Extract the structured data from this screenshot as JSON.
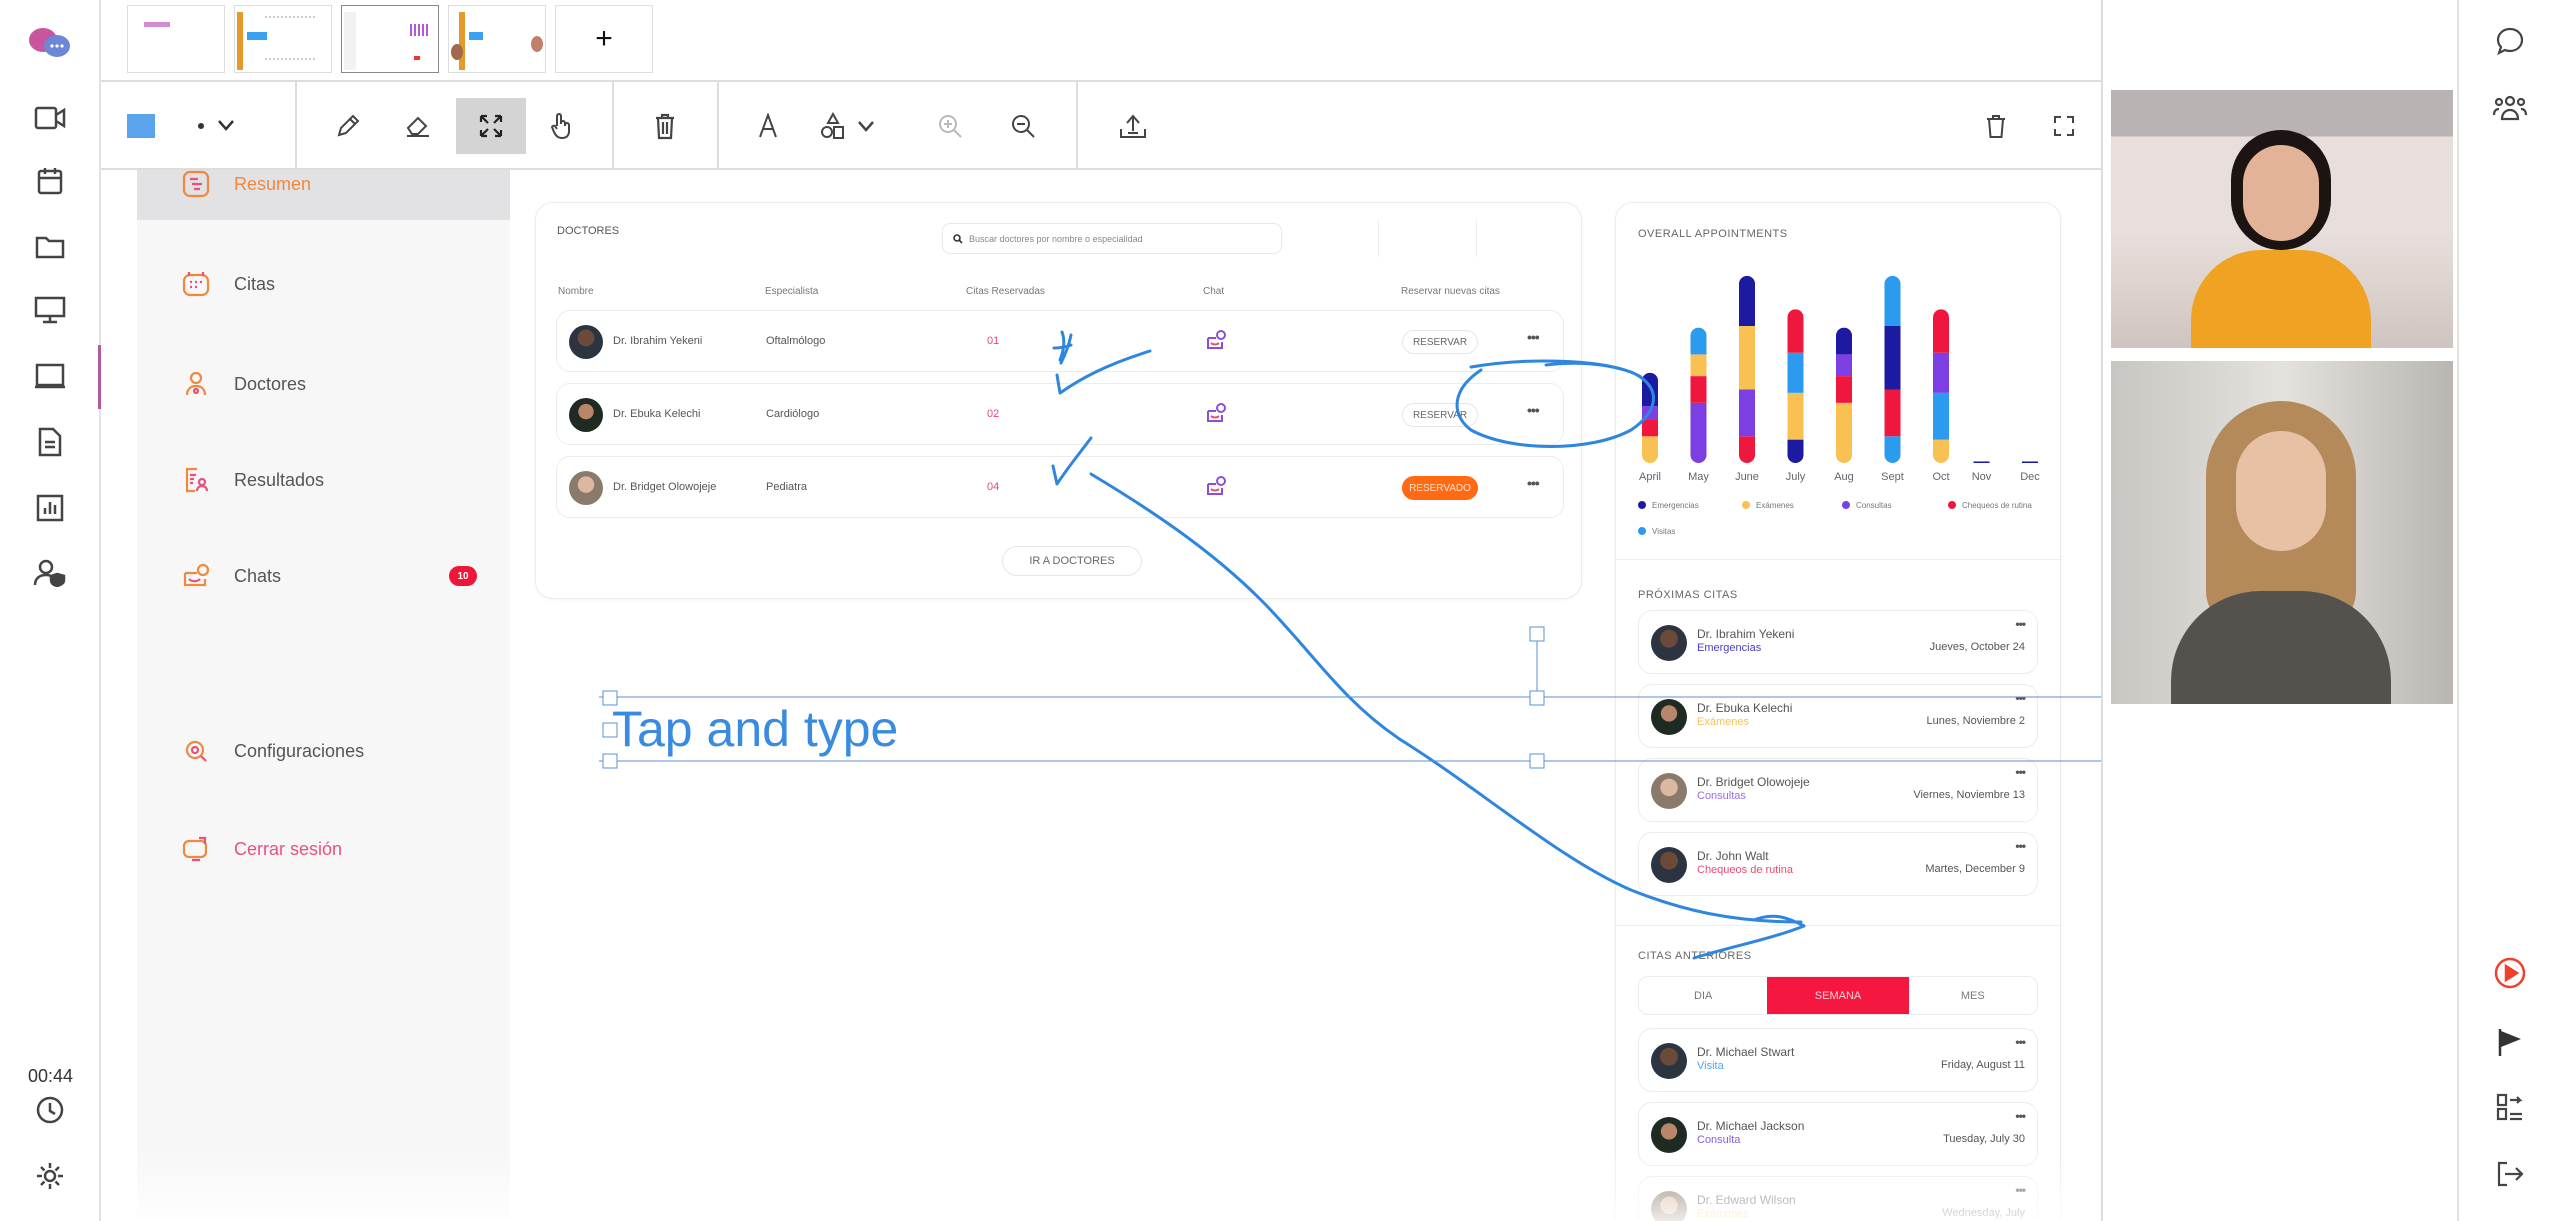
{
  "rail": {
    "timer": "00:44"
  },
  "thumbnails": {
    "add_label": "+"
  },
  "toolbar": {
    "color": "#5ba3ec",
    "active_tool": "select"
  },
  "sidebar": {
    "items": [
      {
        "label": "Resumen",
        "icon": "summary-icon"
      },
      {
        "label": "Citas",
        "icon": "calendar-icon"
      },
      {
        "label": "Doctores",
        "icon": "doctor-icon"
      },
      {
        "label": "Resultados",
        "icon": "results-icon"
      },
      {
        "label": "Chats",
        "icon": "chat-icon",
        "badge": "10"
      },
      {
        "label": "Configuraciones",
        "icon": "settings-icon"
      },
      {
        "label": "Cerrar sesión",
        "icon": "logout-icon"
      }
    ]
  },
  "doctors": {
    "title": "DOCTORES",
    "search_placeholder": "Buscar doctores por nombre o especialidad",
    "headers": [
      "Nombre",
      "Especialista",
      "Citas Reservadas",
      "Chat",
      "Reservar nuevas citas"
    ],
    "rows": [
      {
        "name": "Dr. Ibrahim Yekeni",
        "specialty": "Oftalmólogo",
        "count": "01",
        "action": "RESERVAR"
      },
      {
        "name": "Dr. Ebuka Kelechi",
        "specialty": "Cardiólogo",
        "count": "02",
        "action": "RESERVAR"
      },
      {
        "name": "Dr. Bridget Olowojeje",
        "specialty": "Pediatra",
        "count": "04",
        "action": "RESERVADO"
      }
    ],
    "more_button": "IR A DOCTORES"
  },
  "annotation": {
    "text": "Tap and type",
    "ink_color": "#2e86de"
  },
  "chart_data": {
    "type": "bar",
    "stacked": true,
    "title": "OVERALL APPOINTMENTS",
    "categories": [
      "April",
      "May",
      "June",
      "July",
      "Aug",
      "Sept",
      "Oct",
      "Nov",
      "Dec"
    ],
    "legend": [
      {
        "name": "Emergencias",
        "color": "#1c1aa0"
      },
      {
        "name": "Exámenes",
        "color": "#f9c152"
      },
      {
        "name": "Consultas",
        "color": "#7b3fe4"
      },
      {
        "name": "Chequeos de rutina",
        "color": "#f0173f"
      },
      {
        "name": "Visitas",
        "color": "#2b9bf0"
      }
    ],
    "stacks": [
      [
        [
          "Exámenes",
          8
        ],
        [
          "Chequeos de rutina",
          5
        ],
        [
          "Consultas",
          4
        ],
        [
          "Emergencias",
          10
        ]
      ],
      [
        [
          "Consultas",
          18
        ],
        [
          "Chequeos de rutina",
          8
        ],
        [
          "Exámenes",
          6.5
        ],
        [
          "Visitas",
          8
        ]
      ],
      [
        [
          "Chequeos de rutina",
          8
        ],
        [
          "Consultas",
          14
        ],
        [
          "Exámenes",
          19
        ],
        [
          "Emergencias",
          15
        ]
      ],
      [
        [
          "Emergencias",
          7
        ],
        [
          "Exámenes",
          14
        ],
        [
          "Visitas",
          12
        ],
        [
          "Chequeos de rutina",
          13
        ]
      ],
      [
        [
          "Exámenes",
          18
        ],
        [
          "Chequeos de rutina",
          8
        ],
        [
          "Consultas",
          6.5
        ],
        [
          "Emergencias",
          8
        ]
      ],
      [
        [
          "Visitas",
          8
        ],
        [
          "Chequeos de rutina",
          14
        ],
        [
          "Emergencias",
          19
        ],
        [
          "Visitas",
          15
        ]
      ],
      [
        [
          "Exámenes",
          7
        ],
        [
          "Visitas",
          14
        ],
        [
          "Consultas",
          12
        ],
        [
          "Chequeos de rutina",
          13
        ]
      ],
      [
        [
          "Emergencias",
          0.5
        ]
      ],
      [
        [
          "Emergencias",
          0.5
        ]
      ]
    ],
    "ylim": [
      0,
      58
    ],
    "grid": false,
    "legend_position": "bottom"
  },
  "upcoming": {
    "title": "PRÓXIMAS CITAS",
    "items": [
      {
        "name": "Dr. Ibrahim Yekeni",
        "category": "Emergencias",
        "color": "#4a3fc0",
        "date": "Jueves, October 24"
      },
      {
        "name": "Dr. Ebuka Kelechi",
        "category": "Exámenes",
        "color": "#f5c25a",
        "date": "Lunes, Noviembre 2"
      },
      {
        "name": "Dr. Bridget Olowojeje",
        "category": "Consultas",
        "color": "#9b6be8",
        "date": "Viernes, Noviembre 13"
      },
      {
        "name": "Dr. John Walt",
        "category": "Chequeos de rutina",
        "color": "#ee4a70",
        "date": "Martes, December 9"
      }
    ]
  },
  "past": {
    "title": "CITAS ANTERIORES",
    "tabs": [
      "DIA",
      "SEMANA",
      "MES"
    ],
    "active_tab": "SEMANA",
    "items": [
      {
        "name": "Dr. Michael Stwart",
        "category": "Visita",
        "color": "#4aa8f0",
        "date": "Friday, August 11"
      },
      {
        "name": "Dr. Michael Jackson",
        "category": "Consulta",
        "color": "#8a5ee0",
        "date": "Tuesday, July 30"
      },
      {
        "name": "Dr. Edward Wilson",
        "category": "Exámenes",
        "color": "#f5c25a",
        "date": "Wednesday, July"
      }
    ]
  }
}
